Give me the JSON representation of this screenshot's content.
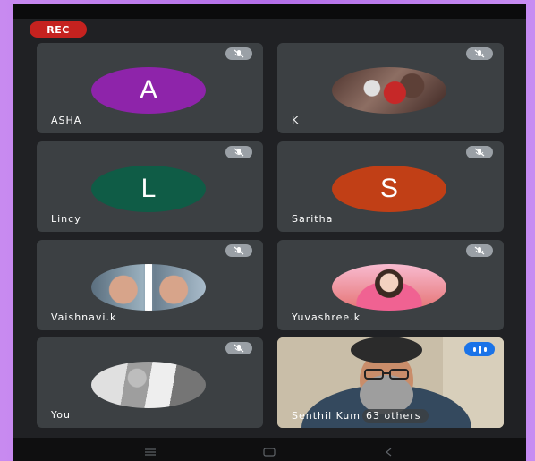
{
  "recording": {
    "label": "REC",
    "color": "#c5221f"
  },
  "participants": [
    {
      "name": "ASHA",
      "initial": "A",
      "avatar_color": "#8e24aa",
      "muted": true,
      "type": "initial"
    },
    {
      "name": "K",
      "initial": "",
      "muted": true,
      "type": "photo",
      "photo": "motorbike"
    },
    {
      "name": "Lincy",
      "initial": "L",
      "avatar_color": "#0f5c46",
      "muted": true,
      "type": "initial"
    },
    {
      "name": "Saritha",
      "initial": "S",
      "avatar_color": "#c13f16",
      "muted": true,
      "type": "initial"
    },
    {
      "name": "Vaishnavi.k",
      "initial": "",
      "muted": true,
      "type": "photo",
      "photo": "portrait-split"
    },
    {
      "name": "Yuvashree.k",
      "initial": "",
      "muted": true,
      "type": "photo",
      "photo": "portrait-pink"
    },
    {
      "name": "You",
      "initial": "",
      "muted": true,
      "type": "photo",
      "photo": "portrait-grey"
    }
  ],
  "active_speaker": {
    "name": "Senthil Kum",
    "others": "63 others",
    "speaking_icon": "audio-bars-icon"
  },
  "nav": {
    "menu_icon": "recents-icon",
    "home_icon": "home-icon",
    "back_icon": "back-icon"
  }
}
